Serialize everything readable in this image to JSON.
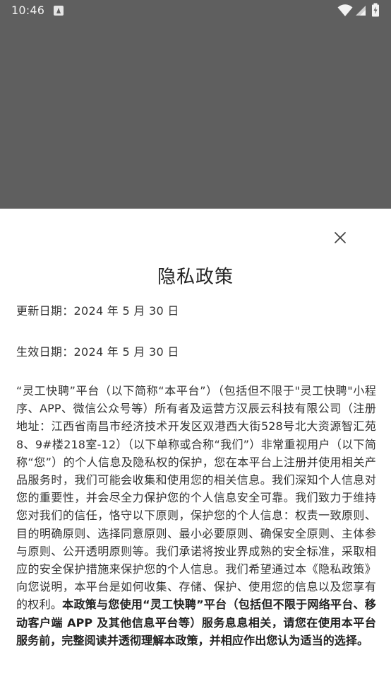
{
  "status_bar": {
    "time": "10:46"
  },
  "policy": {
    "title": "隐私政策",
    "updated_date": "更新日期：2024 年 5 月 30 日",
    "effective_date": "生效日期：2024 年 5 月 30 日",
    "body_regular": "“灵工快聘”平台（以下简称“本平台”）（包括但不限于\"灵工快聘\"小程序、APP、微信公众号等）所有者及运营方汉辰云科技有限公司（注册地址：江西省南昌市经济技术开发区双港西大街528号北大资源智汇苑8、9#楼218室-12）（以下单称或合称“我们”）非常重视用户（以下简称“您”）的个人信息及隐私权的保护，您在本平台上注册并使用相关产品服务时，我们可能会收集和使用您的相关信息。我们深知个人信息对您的重要性，并会尽全力保护您的个人信息安全可靠。我们致力于维持您对我们的信任，恪守以下原则，保护您的个人信息：权责一致原则、目的明确原则、选择同意原则、最小必要原则、确保安全原则、主体参与原则、公开透明原则等。我们承诺将按业界成熟的安全标准，采取相应的安全保护措施来保护您的个人信息。我们希望通过本《隐私政策》向您说明，本平台是如何收集、存储、保护、使用您的信息以及您享有的权利。",
    "body_bold": "本政策与您使用“灵工快聘”平台（包括但不限于网络平台、移动客户端 APP 及其他信息平台等）服务息息相关，请您在使用本平台服务前，完整阅读并透彻理解本政策，并相应作出您认为适当的选择。"
  },
  "icons": {
    "close": "close-icon",
    "wifi": "wifi-icon",
    "signal": "cell-signal-icon",
    "battery": "battery-icon",
    "notification": "notification-icon"
  },
  "colors": {
    "scrim": "#5f5f5f",
    "sheet_background": "#ffffff",
    "text": "#333333"
  }
}
